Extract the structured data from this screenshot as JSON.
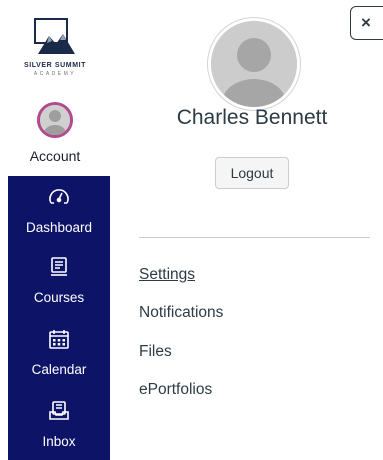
{
  "brand": {
    "name": "SILVER SUMMIT",
    "subtitle": "ACADEMY"
  },
  "nav": {
    "account_label": "Account",
    "items": [
      {
        "label": "Dashboard",
        "icon": "dashboard-gauge-icon"
      },
      {
        "label": "Courses",
        "icon": "courses-book-icon"
      },
      {
        "label": "Calendar",
        "icon": "calendar-icon"
      },
      {
        "label": "Inbox",
        "icon": "inbox-icon"
      }
    ]
  },
  "tray": {
    "close_label": "×",
    "user_name": "Charles Bennett",
    "logout_label": "Logout",
    "links": [
      {
        "label": "Settings"
      },
      {
        "label": "Notifications"
      },
      {
        "label": "Files"
      },
      {
        "label": "ePortfolios"
      }
    ]
  },
  "colors": {
    "nav_background": "#0d1468",
    "account_ring": "#b24a8f",
    "text": "#2d3b45"
  }
}
